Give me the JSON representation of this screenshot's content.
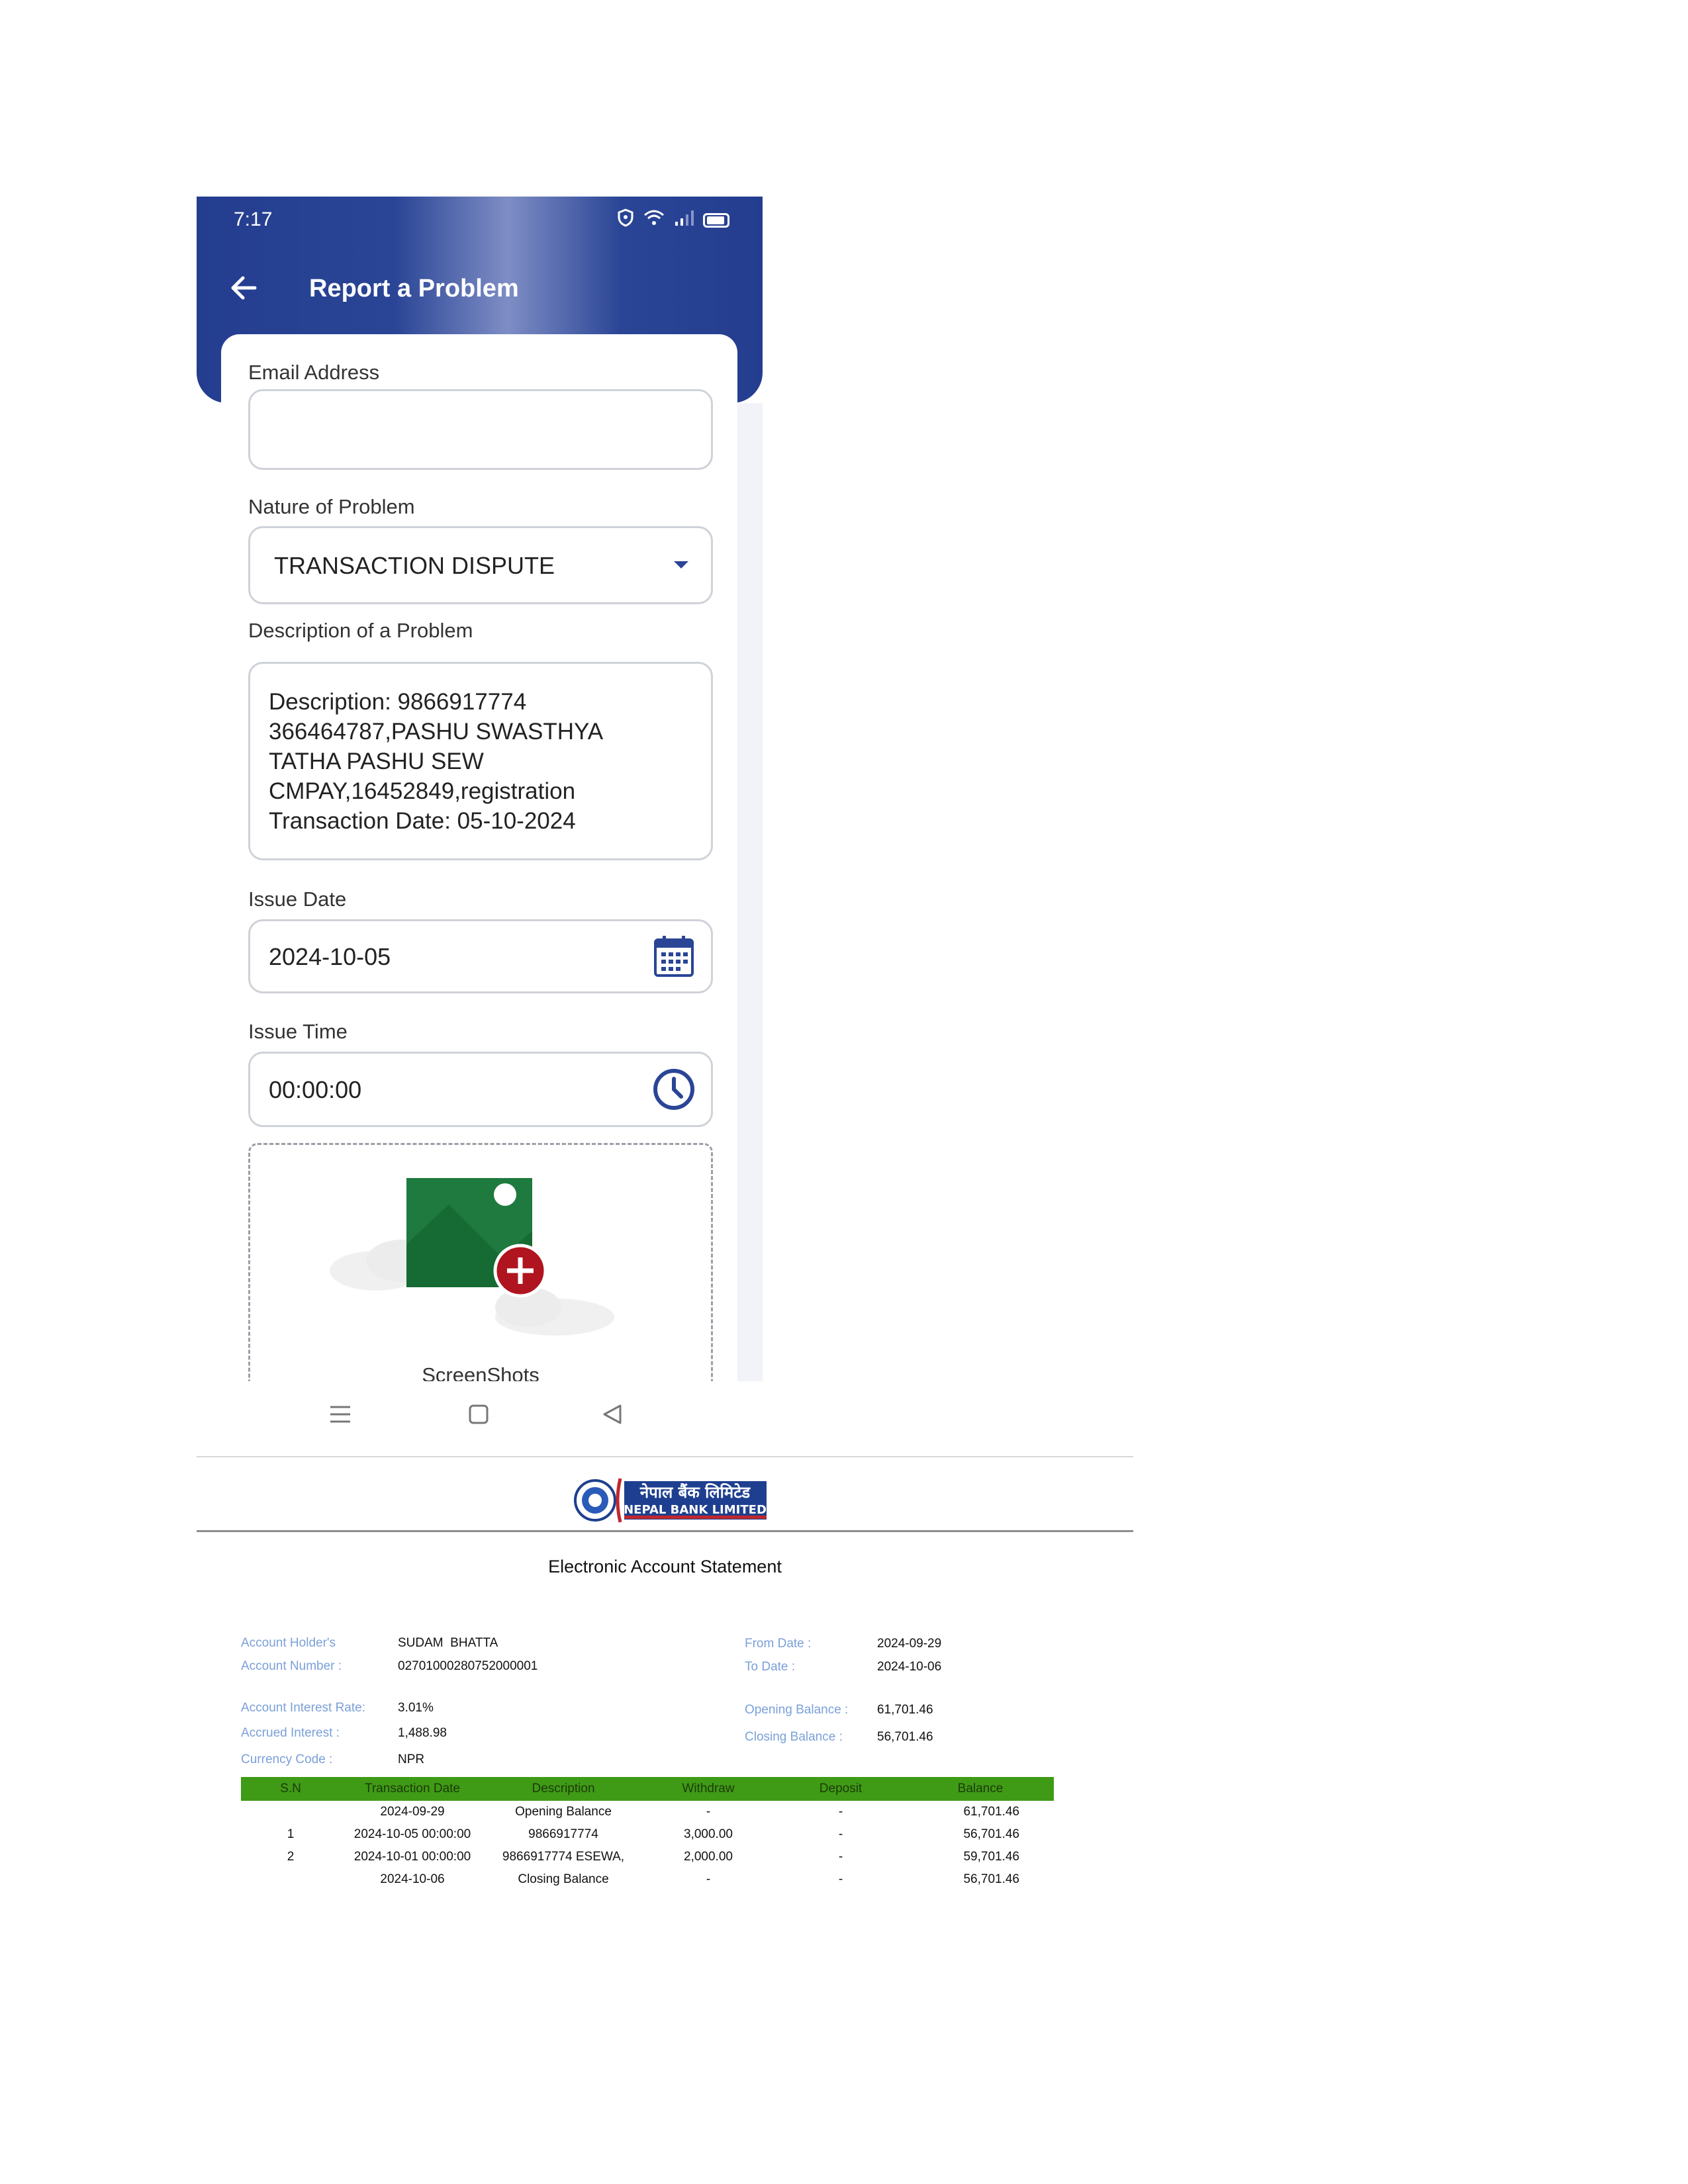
{
  "phone": {
    "status_bar": {
      "time": "7:17"
    },
    "header": {
      "title": "Report a Problem"
    },
    "form": {
      "email": {
        "label": "Email Address",
        "value": ""
      },
      "nature": {
        "label": "Nature of Problem",
        "value": "TRANSACTION DISPUTE"
      },
      "description": {
        "label": "Description of a Problem",
        "value": "Description: 9866917774\n366464787,PASHU SWASTHYA\nTATHA PASHU SEW\nCMPAY,16452849,registration\nTransaction Date: 05-10-2024"
      },
      "issue_date": {
        "label": "Issue Date",
        "value": "2024-10-05"
      },
      "issue_time": {
        "label": "Issue Time",
        "value": "00:00:00"
      },
      "screenshots": {
        "label": "ScreenShots"
      }
    },
    "colors": {
      "header": "#2a4596",
      "accent": "#2a4596",
      "add_badge": "#b0141e",
      "image_green": "#1e7a3e"
    }
  },
  "statement": {
    "bank_logo_text": "नेपाल बैंक लिमिटेड NEPAL BANK LIMITED",
    "title": "Electronic Account Statement",
    "info": {
      "holder_label": "Account Holder's",
      "holder_value": "SUDAM  BHATTA",
      "number_label": "Account Number :",
      "number_value": "02701000280752000001",
      "rate_label": "Account Interest Rate:",
      "rate_value": "3.01%",
      "accrued_label": "Accrued Interest :",
      "accrued_value": "1,488.98",
      "currency_label": "Currency Code :",
      "currency_value": "NPR",
      "from_label": "From Date :",
      "from_value": "2024-09-29",
      "to_label": "To Date :",
      "to_value": "2024-10-06",
      "opening_label": "Opening Balance :",
      "opening_value": "61,701.46",
      "closing_label": "Closing Balance :",
      "closing_value": "56,701.46"
    },
    "table": {
      "headers": [
        "S.N",
        "Transaction Date",
        "Description",
        "Withdraw",
        "Deposit",
        "Balance"
      ],
      "rows": [
        [
          "",
          "2024-09-29",
          "Opening Balance",
          "-",
          "-",
          "61,701.46"
        ],
        [
          "1",
          "2024-10-05 00:00:00",
          "9866917774",
          "3,000.00",
          "-",
          "56,701.46"
        ],
        [
          "2",
          "2024-10-01 00:00:00",
          "9866917774 ESEWA,",
          "2,000.00",
          "-",
          "59,701.46"
        ],
        [
          "",
          "2024-10-06",
          "Closing Balance",
          "-",
          "-",
          "56,701.46"
        ]
      ]
    },
    "colors": {
      "table_header": "#3f9a16",
      "label": "#7ba0d8"
    }
  }
}
